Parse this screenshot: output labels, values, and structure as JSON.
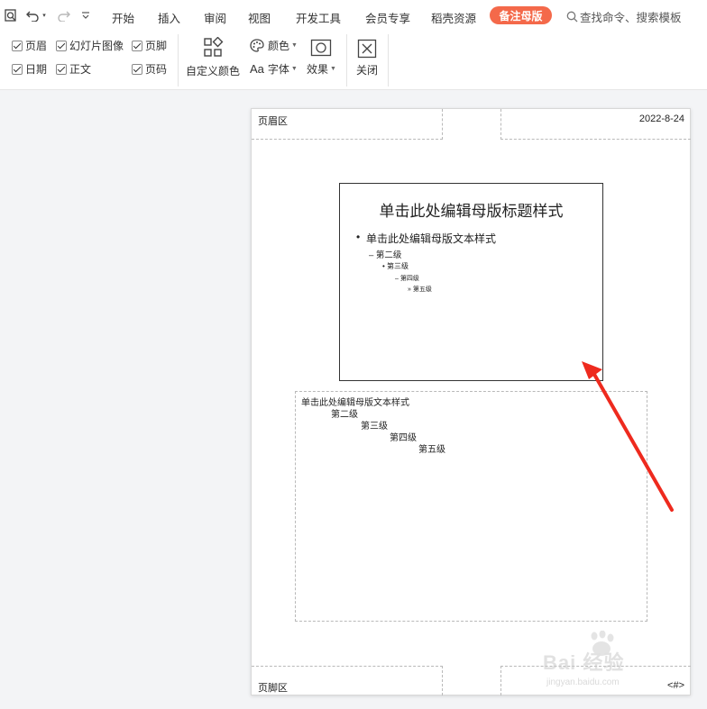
{
  "menubar": {
    "tabs": [
      "开始",
      "插入",
      "审阅",
      "视图",
      "开发工具",
      "会员专享",
      "稻壳资源"
    ],
    "active_tab": "备注母版",
    "search_placeholder": "查找命令、搜索模板"
  },
  "ribbon": {
    "checkboxes": {
      "header": "页眉",
      "slide_image": "幻灯片图像",
      "footer": "页脚",
      "date": "日期",
      "body": "正文",
      "page_number": "页码"
    },
    "custom_color": "自定义颜色",
    "colors": "颜色",
    "font": "字体",
    "font_prefix": "Aa",
    "effects": "效果",
    "close": "关闭"
  },
  "notes_page": {
    "header_text": "页眉区",
    "date_text": "2022-8-24",
    "footer_text": "页脚区",
    "page_number_text": "<#>",
    "slide": {
      "title": "单击此处编辑母版标题样式",
      "body": "单击此处编辑母版文本样式",
      "level2": "– 第二级",
      "level3": "• 第三级",
      "level4": "– 第四级",
      "level5": "» 第五级"
    },
    "notes": {
      "level1": "单击此处编辑母版文本样式",
      "level2": "第二级",
      "level3": "第三级",
      "level4": "第四级",
      "level5": "第五级"
    }
  },
  "watermark": {
    "main": "Bai 经验",
    "sub": "jingyan.baidu.com"
  },
  "colors": {
    "accent": "#f4694a",
    "arrow": "#ee2a1e"
  }
}
